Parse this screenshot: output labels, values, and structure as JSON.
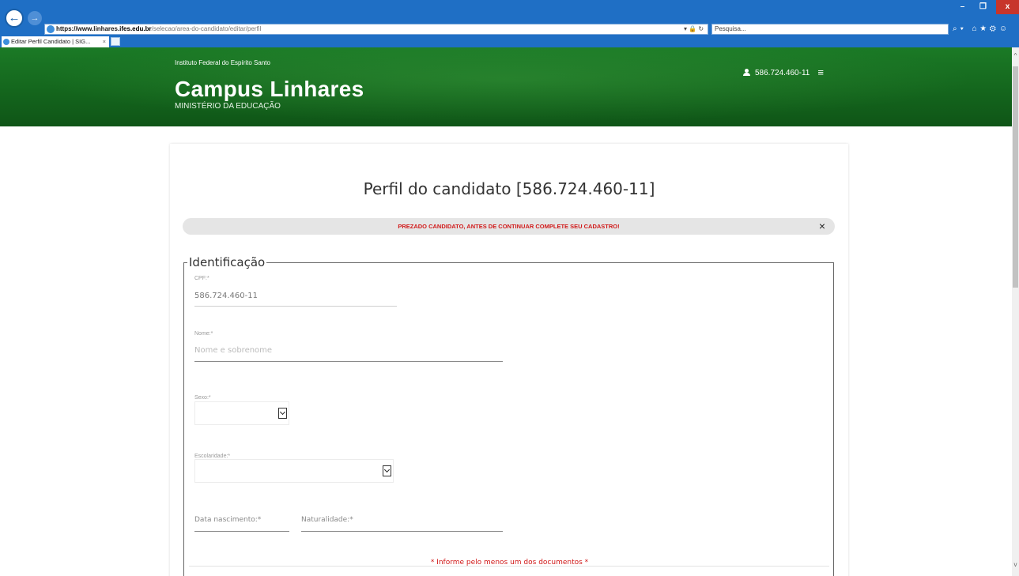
{
  "browser": {
    "url_scheme": "https://www.linhares.",
    "url_domain": "ifes.edu.br",
    "url_path": "/selecao/area-do-candidato/editar/perfil",
    "search_placeholder": "Pesquisa...",
    "tab_title": "Editar Perfil Candidato | SIG...",
    "tab_close": "×",
    "addr_tools": "▾ 🔒 ↻",
    "right_tools": "⌕▾ ⌂★⚙☺",
    "min_label": "–",
    "max_label": "❐",
    "close_label": "x"
  },
  "header": {
    "org_name": "Instituto Federal do Espírito Santo",
    "title": "Campus Linhares",
    "subtitle": "MINISTÉRIO DA EDUCAÇÃO",
    "user_id": "586.724.460-11",
    "menu_icon": "≡"
  },
  "page": {
    "title": "Perfil do candidato [586.724.460-11]",
    "alert_text": "PREZADO CANDIDATO, ANTES DE CONTINUAR COMPLETE SEU CADASTRO!",
    "alert_close": "×"
  },
  "form": {
    "legend": "Identificação",
    "cpf": {
      "label": "CPF:*",
      "value": "586.724.460-11"
    },
    "nome": {
      "label": "Nome:*",
      "placeholder": "Nome e sobrenome"
    },
    "sexo": {
      "label": "Sexo:*",
      "value": ""
    },
    "escolaridade": {
      "label": "Escolaridade:*",
      "value": ""
    },
    "data_nascimento": {
      "label": "Data nascimento:*"
    },
    "naturalidade": {
      "label": "Naturalidade:*"
    },
    "documents_note": "* Informe pelo menos um dos documentos *"
  },
  "colors": {
    "header_green": "#14661d",
    "alert_red": "#d11a1a",
    "browser_blue": "#1f6fc5"
  }
}
